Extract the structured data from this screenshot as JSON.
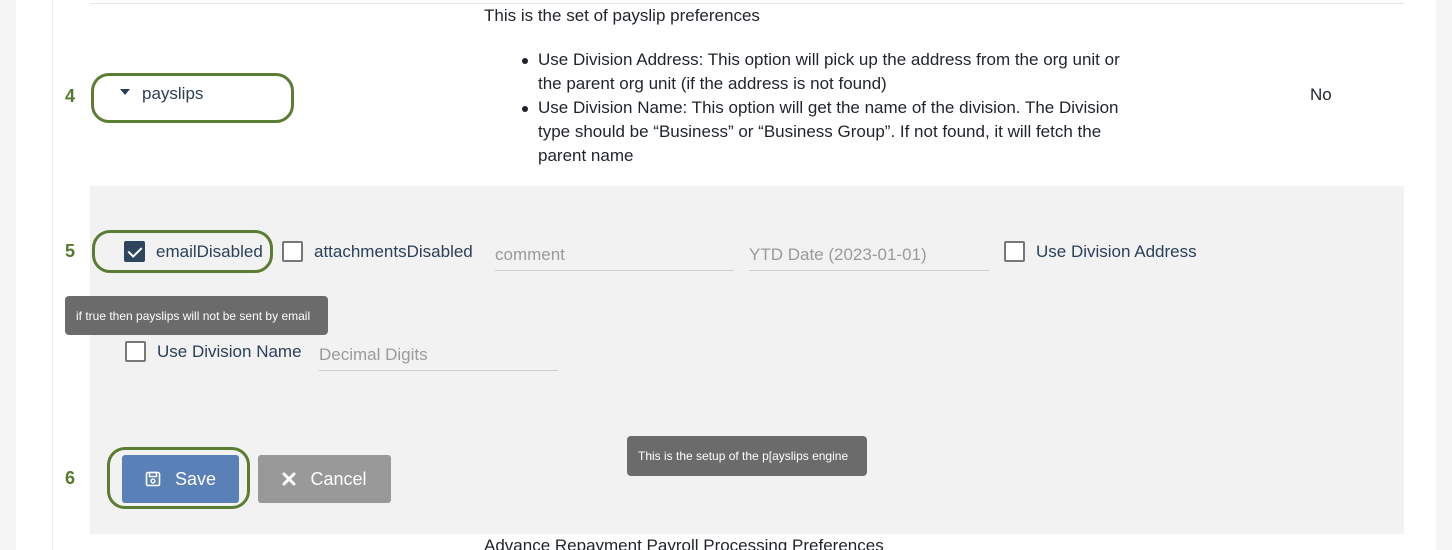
{
  "payslips_row": {
    "step": "4",
    "toggle_label": "payslips",
    "description_title": "This is the set of payslip preferences",
    "description_items": [
      "Use Division Address: This option will pick up the address from the org unit or the parent org unit (if the address is not found)",
      "Use Division Name: This option will get the name of the division. The Division type should be “Business” or “Business Group”. If not found, it will fetch the parent name"
    ],
    "value": "No"
  },
  "settings": {
    "step": "5",
    "email_disabled": {
      "label": "emailDisabled",
      "checked": true
    },
    "attachments_disabled": {
      "label": "attachmentsDisabled",
      "checked": false
    },
    "comment": {
      "placeholder": "comment",
      "value": ""
    },
    "ytd_date": {
      "placeholder": "YTD Date (2023-01-01)",
      "value": ""
    },
    "use_division_address": {
      "label": "Use Division Address",
      "checked": false
    },
    "use_division_name": {
      "label": "Use Division Name",
      "checked": false
    },
    "decimal_digits": {
      "placeholder": "Decimal Digits",
      "value": ""
    },
    "email_tooltip": "if true then payslips will not be sent by email"
  },
  "actions": {
    "step": "6",
    "save_label": "Save",
    "save_icon": "floppy-disk-icon",
    "cancel_label": "Cancel",
    "cancel_icon": "close-icon",
    "engine_tooltip": "This is the setup of the p[ayslips engine"
  },
  "next_section_title": "Advance Repayment Payroll Processing Preferences",
  "colors": {
    "step_green": "#557a2a",
    "highlight_border": "#5a7d33",
    "save_blue": "#5a80b8",
    "cancel_gray": "#999999",
    "tooltip_gray": "#6b6b6b",
    "checkbox_checked": "#2e4560"
  }
}
